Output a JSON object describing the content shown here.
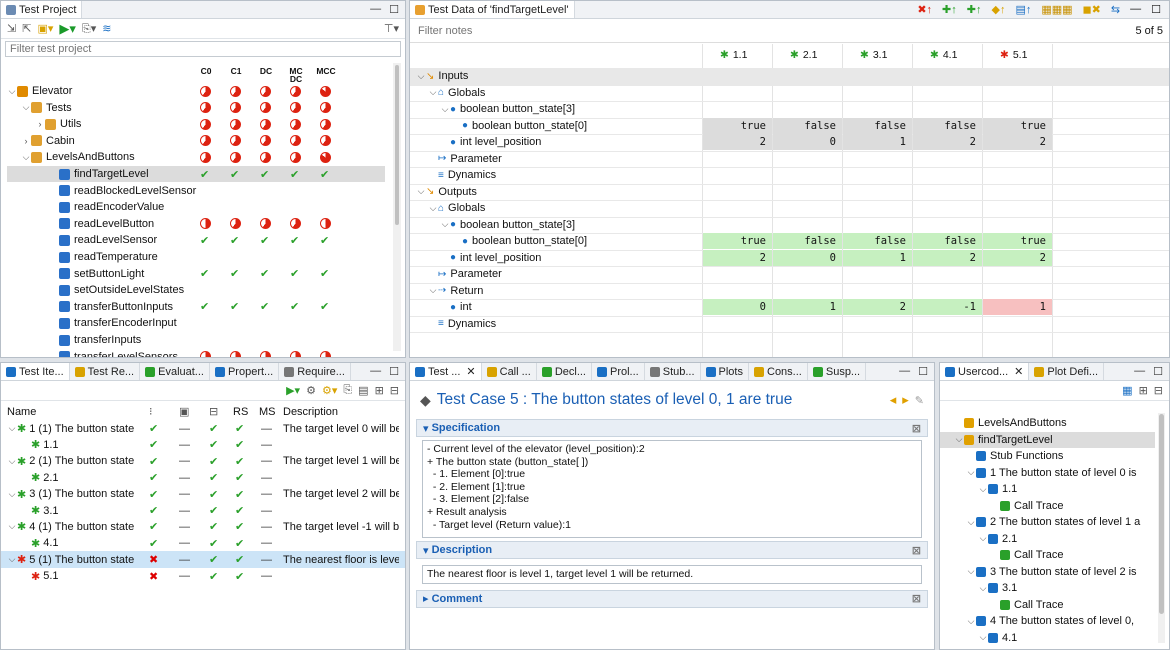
{
  "test_project": {
    "tab": "Test Project",
    "filter": "Filter test project",
    "cols": [
      "C0",
      "C1",
      "DC",
      "MC DC",
      "MCC"
    ],
    "tree": [
      {
        "label": "Elevator",
        "depth": 0,
        "exp": "v",
        "cov": [
          "p",
          "p",
          "p",
          "p",
          "f"
        ]
      },
      {
        "label": "Tests",
        "depth": 1,
        "exp": "v",
        "cov": [
          "p",
          "p",
          "p",
          "p",
          "p"
        ]
      },
      {
        "label": "Utils",
        "depth": 2,
        "exp": ">",
        "cov": [
          "p",
          "p",
          "p",
          "p",
          "p"
        ]
      },
      {
        "label": "Cabin",
        "depth": 1,
        "exp": ">",
        "cov": [
          "p",
          "p",
          "p",
          "p",
          "p"
        ]
      },
      {
        "label": "LevelsAndButtons",
        "depth": 1,
        "exp": "v",
        "cov": [
          "p",
          "p",
          "p",
          "p",
          "f"
        ]
      },
      {
        "label": "findTargetLevel",
        "depth": 3,
        "exp": "",
        "cov": [
          "c",
          "c",
          "c",
          "c",
          "c"
        ],
        "sel": true
      },
      {
        "label": "readBlockedLevelSensor",
        "depth": 3,
        "exp": "",
        "cov": []
      },
      {
        "label": "readEncoderValue",
        "depth": 3,
        "exp": "",
        "cov": []
      },
      {
        "label": "readLevelButton",
        "depth": 3,
        "exp": "",
        "cov": [
          "h",
          "p",
          "p",
          "p",
          "h"
        ]
      },
      {
        "label": "readLevelSensor",
        "depth": 3,
        "exp": "",
        "cov": [
          "c",
          "c",
          "c",
          "c",
          "c"
        ]
      },
      {
        "label": "readTemperature",
        "depth": 3,
        "exp": "",
        "cov": []
      },
      {
        "label": "setButtonLight",
        "depth": 3,
        "exp": "",
        "cov": [
          "c",
          "c",
          "c",
          "c",
          "c"
        ]
      },
      {
        "label": "setOutsideLevelStates",
        "depth": 3,
        "exp": "",
        "cov": []
      },
      {
        "label": "transferButtonInputs",
        "depth": 3,
        "exp": "",
        "cov": [
          "c",
          "c",
          "c",
          "c",
          "c"
        ]
      },
      {
        "label": "transferEncoderInput",
        "depth": 3,
        "exp": "",
        "cov": []
      },
      {
        "label": "transferInputs",
        "depth": 3,
        "exp": "",
        "cov": []
      },
      {
        "label": "transferLevelSensors",
        "depth": 3,
        "exp": "",
        "cov": [
          "p",
          "p",
          "p",
          "p",
          "p"
        ]
      }
    ]
  },
  "test_data": {
    "tab": "Test Data of 'findTargetLevel'",
    "filter": "Filter notes",
    "count": "5 of 5",
    "cases": [
      "1.1",
      "2.1",
      "3.1",
      "4.1",
      "5.1"
    ],
    "rows": [
      {
        "label": "Inputs",
        "depth": 0,
        "exp": "v",
        "kind": "sec",
        "vals": []
      },
      {
        "label": "Globals",
        "depth": 1,
        "exp": "v",
        "kind": "glob",
        "vals": []
      },
      {
        "label": "boolean button_state[3]",
        "depth": 2,
        "exp": "v",
        "kind": "dot",
        "vals": []
      },
      {
        "label": "boolean  button_state[0]",
        "depth": 3,
        "exp": "",
        "kind": "dot",
        "vals": [
          "true",
          "false",
          "false",
          "false",
          "true"
        ],
        "bg": "gray"
      },
      {
        "label": "int level_position",
        "depth": 2,
        "exp": "",
        "kind": "dot",
        "vals": [
          "2",
          "0",
          "1",
          "2",
          "2"
        ],
        "bg": "gray"
      },
      {
        "label": "Parameter",
        "depth": 1,
        "exp": "",
        "kind": "param",
        "vals": []
      },
      {
        "label": "Dynamics",
        "depth": 1,
        "exp": "",
        "kind": "dyn",
        "vals": []
      },
      {
        "label": "Outputs",
        "depth": 0,
        "exp": "v",
        "kind": "sec",
        "vals": []
      },
      {
        "label": "Globals",
        "depth": 1,
        "exp": "v",
        "kind": "glob",
        "vals": []
      },
      {
        "label": "boolean button_state[3]",
        "depth": 2,
        "exp": "v",
        "kind": "dot",
        "vals": []
      },
      {
        "label": "boolean  button_state[0]",
        "depth": 3,
        "exp": "",
        "kind": "dot",
        "vals": [
          "true",
          "false",
          "false",
          "false",
          "true"
        ],
        "bg": "green"
      },
      {
        "label": "int level_position",
        "depth": 2,
        "exp": "",
        "kind": "dot",
        "vals": [
          "2",
          "0",
          "1",
          "2",
          "2"
        ],
        "bg": "green"
      },
      {
        "label": "Parameter",
        "depth": 1,
        "exp": "",
        "kind": "param",
        "vals": []
      },
      {
        "label": "Return",
        "depth": 1,
        "exp": "v",
        "kind": "ret",
        "vals": []
      },
      {
        "label": "int",
        "depth": 2,
        "exp": "",
        "kind": "dot",
        "vals": [
          "0",
          "1",
          "2",
          "-1",
          "1"
        ],
        "bg": "green",
        "last_red": true
      },
      {
        "label": "Dynamics",
        "depth": 1,
        "exp": "",
        "kind": "dyn",
        "vals": []
      }
    ]
  },
  "test_items": {
    "tabs": [
      "Test Ite...",
      "Test Re...",
      "Evaluat...",
      "Propert...",
      "Require..."
    ],
    "headers": [
      "Name",
      "",
      "",
      "",
      "RS",
      "MS",
      "Description"
    ],
    "rows": [
      {
        "name": "1 (1) The button state",
        "depth": 0,
        "marks": [
          "c",
          "d",
          "c",
          "c",
          "d"
        ],
        "desc": "The target level 0 will be"
      },
      {
        "name": "1.1",
        "depth": 1,
        "marks": [
          "c",
          "d",
          "c",
          "c",
          "d"
        ],
        "desc": ""
      },
      {
        "name": "2 (1) The button state",
        "depth": 0,
        "marks": [
          "c",
          "d",
          "c",
          "c",
          "d"
        ],
        "desc": "The target level 1 will be"
      },
      {
        "name": "2.1",
        "depth": 1,
        "marks": [
          "c",
          "d",
          "c",
          "c",
          "d"
        ],
        "desc": ""
      },
      {
        "name": "3 (1) The button state",
        "depth": 0,
        "marks": [
          "c",
          "d",
          "c",
          "c",
          "d"
        ],
        "desc": "The target level 2 will be"
      },
      {
        "name": "3.1",
        "depth": 1,
        "marks": [
          "c",
          "d",
          "c",
          "c",
          "d"
        ],
        "desc": ""
      },
      {
        "name": "4 (1) The button state",
        "depth": 0,
        "marks": [
          "c",
          "d",
          "c",
          "c",
          "d"
        ],
        "desc": "The target level -1 will be"
      },
      {
        "name": "4.1",
        "depth": 1,
        "marks": [
          "c",
          "d",
          "c",
          "c",
          "d"
        ],
        "desc": ""
      },
      {
        "name": "5 (1) The button state",
        "depth": 0,
        "marks": [
          "x",
          "d",
          "c",
          "c",
          "d"
        ],
        "desc": "The nearest floor is level",
        "sel": true
      },
      {
        "name": "5.1",
        "depth": 1,
        "marks": [
          "x",
          "d",
          "c",
          "c",
          "d"
        ],
        "desc": ""
      }
    ]
  },
  "test_case": {
    "tabs": [
      "Test ...",
      "Call ...",
      "Decl...",
      "Prol...",
      "Stub...",
      "Plots",
      "Cons...",
      "Susp..."
    ],
    "title": "Test Case 5 : The button states of level 0, 1 are true",
    "spec_label": "Specification",
    "spec_lines": [
      "- Current level of the elevator (level_position):2",
      "+ The button state (button_state[ ])",
      "  - 1. Element [0]:true",
      "  - 2. Element [1]:true",
      "  - 3. Element [2]:false",
      "+ Result analysis",
      "  - Target level (Return value):1"
    ],
    "desc_label": "Description",
    "desc_text": "The nearest floor is level 1, target level 1 will be returned.",
    "comment_label": "Comment"
  },
  "usercode": {
    "tabs": [
      "Usercod...",
      "Plot Defi..."
    ],
    "tree": [
      {
        "label": "LevelsAndButtons",
        "depth": 0,
        "exp": ""
      },
      {
        "label": "findTargetLevel",
        "depth": 0,
        "exp": "v",
        "sel": true
      },
      {
        "label": "Stub Functions",
        "depth": 1,
        "exp": ""
      },
      {
        "label": "1 The button state of level 0 is",
        "depth": 1,
        "exp": "v"
      },
      {
        "label": "1.1",
        "depth": 2,
        "exp": "v"
      },
      {
        "label": "Call Trace",
        "depth": 3,
        "exp": ""
      },
      {
        "label": "2 The button states of level 1 a",
        "depth": 1,
        "exp": "v"
      },
      {
        "label": "2.1",
        "depth": 2,
        "exp": "v"
      },
      {
        "label": "Call Trace",
        "depth": 3,
        "exp": ""
      },
      {
        "label": "3 The button state of level 2 is",
        "depth": 1,
        "exp": "v"
      },
      {
        "label": "3.1",
        "depth": 2,
        "exp": "v"
      },
      {
        "label": "Call Trace",
        "depth": 3,
        "exp": ""
      },
      {
        "label": "4 The button states of level 0,",
        "depth": 1,
        "exp": "v"
      },
      {
        "label": "4.1",
        "depth": 2,
        "exp": "v"
      },
      {
        "label": "Call Trace",
        "depth": 3,
        "exp": ""
      }
    ]
  },
  "colors": {
    "accent": "#1a5fb4",
    "pass": "#2aa02a",
    "fail": "#d21",
    "green_cell": "#c6f0c0",
    "red_cell": "#f7c0c0"
  }
}
